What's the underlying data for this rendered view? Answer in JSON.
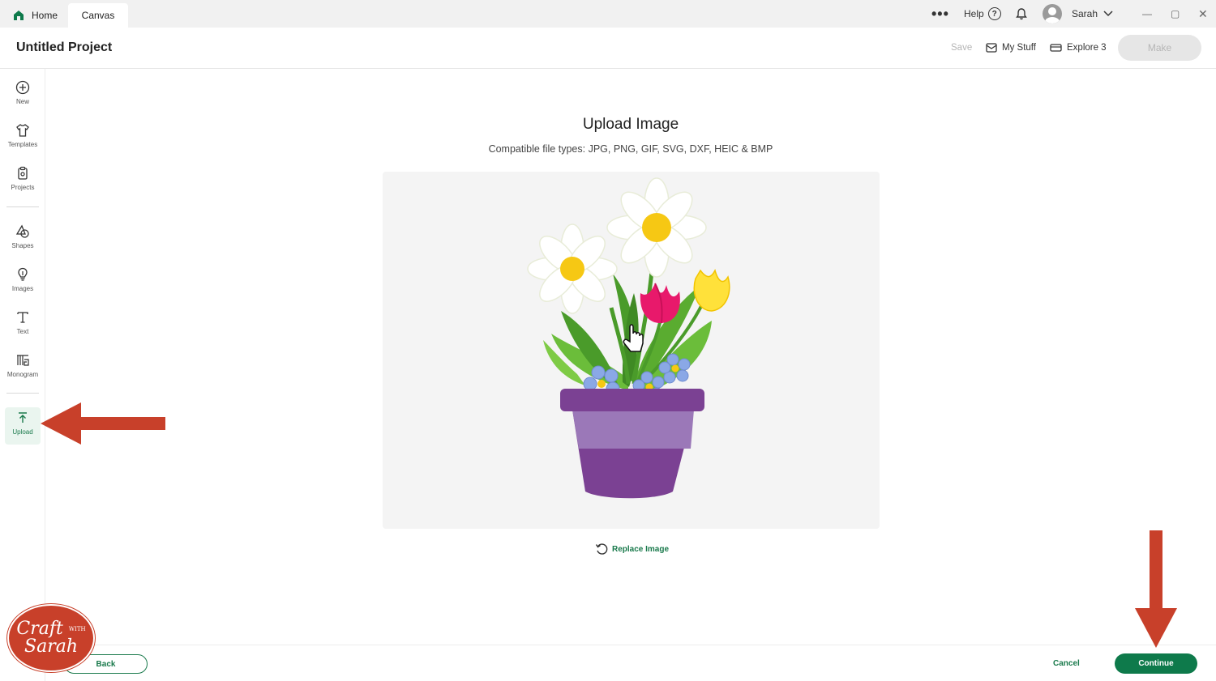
{
  "tabs": {
    "home": "Home",
    "canvas": "Canvas"
  },
  "topbar": {
    "more": "•••",
    "help": "Help",
    "user_name": "Sarah",
    "min": "—",
    "max": "▢",
    "close": "✕"
  },
  "header": {
    "project_title": "Untitled Project",
    "save": "Save",
    "my_stuff": "My Stuff",
    "machine": "Explore 3",
    "make": "Make"
  },
  "sidebar": {
    "items": [
      {
        "label": "New",
        "icon": "plus-circle-icon"
      },
      {
        "label": "Templates",
        "icon": "shirt-icon"
      },
      {
        "label": "Projects",
        "icon": "clipboard-icon"
      },
      {
        "label": "Shapes",
        "icon": "shapes-icon"
      },
      {
        "label": "Images",
        "icon": "lightbulb-icon"
      },
      {
        "label": "Text",
        "icon": "text-icon"
      },
      {
        "label": "Monogram",
        "icon": "monogram-icon"
      },
      {
        "label": "Upload",
        "icon": "upload-icon",
        "active": true
      }
    ]
  },
  "main": {
    "title": "Upload Image",
    "compatible_label": "Compatible file types:",
    "compatible_types": "JPG, PNG, GIF, SVG, DXF, HEIC & BMP",
    "replace": "Replace Image"
  },
  "footer": {
    "back": "Back",
    "cancel": "Cancel",
    "continue": "Continue"
  },
  "watermark": {
    "line1": "Craft",
    "with": "WITH",
    "line2": "Sarah"
  },
  "colors": {
    "accent": "#0e7a4b",
    "annotation": "#c8402a",
    "pot": "#7b4193"
  }
}
